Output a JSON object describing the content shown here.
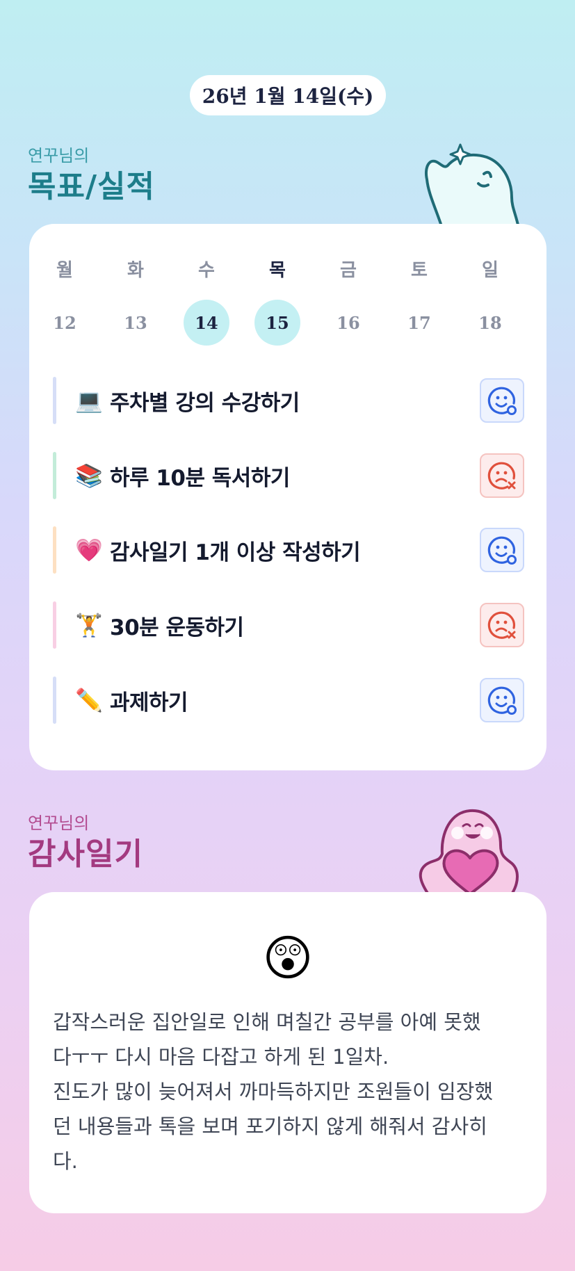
{
  "date_label": "26년 1월 14일(수)",
  "goals_section": {
    "subtitle": "연꾸님의",
    "title": "목표/실적"
  },
  "week": {
    "days": [
      {
        "label": "월",
        "date": "12",
        "highlight": false,
        "today": false
      },
      {
        "label": "화",
        "date": "13",
        "highlight": false,
        "today": false
      },
      {
        "label": "수",
        "date": "14",
        "highlight": true,
        "today": false
      },
      {
        "label": "목",
        "date": "15",
        "highlight": true,
        "today": true
      },
      {
        "label": "금",
        "date": "16",
        "highlight": false,
        "today": false
      },
      {
        "label": "토",
        "date": "17",
        "highlight": false,
        "today": false
      },
      {
        "label": "일",
        "date": "18",
        "highlight": false,
        "today": false
      }
    ]
  },
  "tasks": [
    {
      "emoji": "💻",
      "label": "주차별 강의 수강하기",
      "status": "success",
      "bar_color": "#d6def7",
      "icon": "smile-check-icon"
    },
    {
      "emoji": "📚",
      "label": "하루 10분 독서하기",
      "status": "fail",
      "bar_color": "#c3ecd9",
      "icon": "frown-x-icon"
    },
    {
      "emoji": "💗",
      "label": "감사일기 1개 이상 작성하기",
      "status": "success",
      "bar_color": "#fde0c2",
      "icon": "smile-check-icon"
    },
    {
      "emoji": "🏋️",
      "label": "30분 운동하기",
      "status": "fail",
      "bar_color": "#f8cfe4",
      "icon": "frown-x-icon"
    },
    {
      "emoji": "✏️",
      "label": "과제하기",
      "status": "success",
      "bar_color": "#d6def7",
      "icon": "smile-check-icon"
    }
  ],
  "diary_section": {
    "subtitle": "연꾸님의",
    "title": "감사일기"
  },
  "diary": {
    "emoji": "😲",
    "lines": [
      "갑작스러운 집안일로 인해 며칠간 공부를 아예 못했",
      "다ㅜㅜ 다시 마음 다잡고 하게 된 1일차.",
      "진도가 많이 늦어져서 까마득하지만 조원들이 임장했",
      "던 내용들과 톡을 보며 포기하지 않게 해줘서 감사히",
      "다."
    ]
  },
  "colors": {
    "success": "#2f63e0",
    "fail": "#e0503c",
    "goals_title": "#1d7d8a",
    "diary_title": "#a33a80"
  }
}
